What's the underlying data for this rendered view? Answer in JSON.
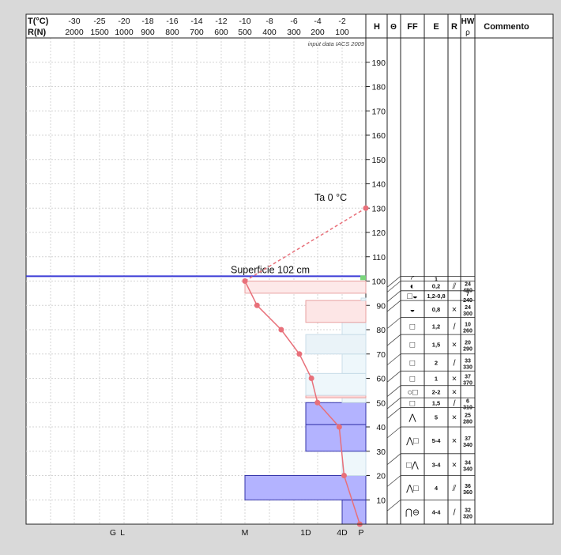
{
  "chart_data": {
    "type": "snow-profile",
    "header": {
      "t_label": "T(°C)",
      "r_label": "R(N)",
      "t_ticks": [
        "-30",
        "-25",
        "-20",
        "-18",
        "-16",
        "-14",
        "-12",
        "-10",
        "-8",
        "-6",
        "-4",
        "-2"
      ],
      "r_ticks": [
        "2000",
        "1500",
        "1000",
        "900",
        "800",
        "700",
        "600",
        "500",
        "400",
        "300",
        "200",
        "100"
      ],
      "columns": [
        "H",
        "Θ",
        "FF",
        "E",
        "R",
        "HW",
        "ρ",
        "Commento"
      ]
    },
    "source_note": "input data IACS 2009",
    "hardness_ticks": [
      "G",
      "L",
      "M",
      "1D",
      "4D",
      "P"
    ],
    "height_axis": {
      "min": 0,
      "max": 200,
      "ticks": [
        "10",
        "20",
        "30",
        "40",
        "50",
        "60",
        "70",
        "80",
        "90",
        "100",
        "110",
        "120",
        "130",
        "140",
        "150",
        "160",
        "170",
        "180",
        "190"
      ]
    },
    "air_temperature": {
      "label": "Ta  0 °C",
      "value": 0
    },
    "snow_surface": {
      "label": "Superficie  102 cm",
      "height": 102
    },
    "temperature_profile": [
      {
        "h": 100,
        "t": -10
      },
      {
        "h": 90,
        "t": -9
      },
      {
        "h": 80,
        "t": -7
      },
      {
        "h": 70,
        "t": -5.5
      },
      {
        "h": 60,
        "t": -4.5
      },
      {
        "h": 50,
        "t": -4
      },
      {
        "h": 40,
        "t": -2.2
      },
      {
        "h": 20,
        "t": -1.8
      },
      {
        "h": 0,
        "t": -0.5
      }
    ],
    "ram_profile": [
      {
        "from": 0,
        "to": 10,
        "resistance": 100,
        "color": "#b3b3ff"
      },
      {
        "from": 10,
        "to": 20,
        "resistance": 500,
        "color": "#b3b3ff"
      },
      {
        "from": 20,
        "to": 30,
        "resistance": 100,
        "color": "#eef7fb"
      },
      {
        "from": 30,
        "to": 41,
        "resistance": 250,
        "color": "#b3b3ff"
      },
      {
        "from": 41,
        "to": 50,
        "resistance": 250,
        "color": "#b3b3ff"
      },
      {
        "from": 50,
        "to": 52,
        "resistance": 100,
        "color": "#eef7fb"
      },
      {
        "from": 52,
        "to": 53,
        "resistance": 250,
        "color": "#ffd6d6"
      },
      {
        "from": 53,
        "to": 62,
        "resistance": 250,
        "color": "#eef7fb"
      },
      {
        "from": 62,
        "to": 70,
        "resistance": 100,
        "color": "#eef7fb"
      },
      {
        "from": 70,
        "to": 78,
        "resistance": 250,
        "color": "#eaf3f8"
      },
      {
        "from": 78,
        "to": 83,
        "resistance": 100,
        "color": "#eef7fb"
      },
      {
        "from": 83,
        "to": 92,
        "resistance": 250,
        "color": "#fde6e6"
      },
      {
        "from": 92,
        "to": 93,
        "resistance": 20,
        "color": "#eef7fb"
      },
      {
        "from": 95,
        "to": 100,
        "resistance": 500,
        "color": "#fde9e9"
      }
    ],
    "layers": [
      {
        "from": 100,
        "to": 102,
        "ff": "◜",
        "e": "1",
        "r": "",
        "hw": "",
        "rho": ""
      },
      {
        "from": 96,
        "to": 100,
        "ff": "◐",
        "e": "0,2",
        "r": "⫽",
        "hw": "24",
        "rho": "480"
      },
      {
        "from": 92,
        "to": 96,
        "ff": "□◒",
        "e": "1,2-0,8",
        "r": "",
        "hw": "7",
        "rho": "240"
      },
      {
        "from": 85,
        "to": 92,
        "ff": "◒",
        "e": "0,8",
        "r": "×",
        "hw": "24",
        "rho": "300"
      },
      {
        "from": 78,
        "to": 85,
        "ff": "□",
        "e": "1,2",
        "r": "/",
        "hw": "10",
        "rho": "260"
      },
      {
        "from": 70,
        "to": 78,
        "ff": "□",
        "e": "1,5",
        "r": "×",
        "hw": "20",
        "rho": "290"
      },
      {
        "from": 63,
        "to": 70,
        "ff": "□",
        "e": "2",
        "r": "/",
        "hw": "33",
        "rho": "330"
      },
      {
        "from": 57,
        "to": 63,
        "ff": "□",
        "e": "1",
        "r": "×",
        "hw": "37",
        "rho": "370"
      },
      {
        "from": 52,
        "to": 57,
        "ff": "○□",
        "e": "2-2",
        "r": "×",
        "hw": "",
        "rho": ""
      },
      {
        "from": 48,
        "to": 52,
        "ff": "□",
        "e": "1,5",
        "r": "/",
        "hw": "6",
        "rho": "310"
      },
      {
        "from": 40,
        "to": 48,
        "ff": "⋀",
        "e": "5",
        "r": "×",
        "hw": "25",
        "rho": "280"
      },
      {
        "from": 29,
        "to": 40,
        "ff": "⋀□",
        "e": "5-4",
        "r": "×",
        "hw": "37",
        "rho": "340"
      },
      {
        "from": 20,
        "to": 29,
        "ff": "□⋀",
        "e": "3-4",
        "r": "×",
        "hw": "34",
        "rho": "340"
      },
      {
        "from": 10,
        "to": 20,
        "ff": "⋀□",
        "e": "4",
        "r": "⫽",
        "hw": "36",
        "rho": "360"
      },
      {
        "from": 0,
        "to": 10,
        "ff": "⋂⊖",
        "e": "4-4",
        "r": "/",
        "hw": "32",
        "rho": "320"
      }
    ],
    "colors": {
      "background": "#d9d9d9",
      "panel": "#ffffff",
      "grid": "#d4d4d4",
      "surface_line": "#3b3bd6",
      "temperature": "#e8707a",
      "ram_border": "#3333aa",
      "surface_marker": "#7ad67a"
    }
  }
}
